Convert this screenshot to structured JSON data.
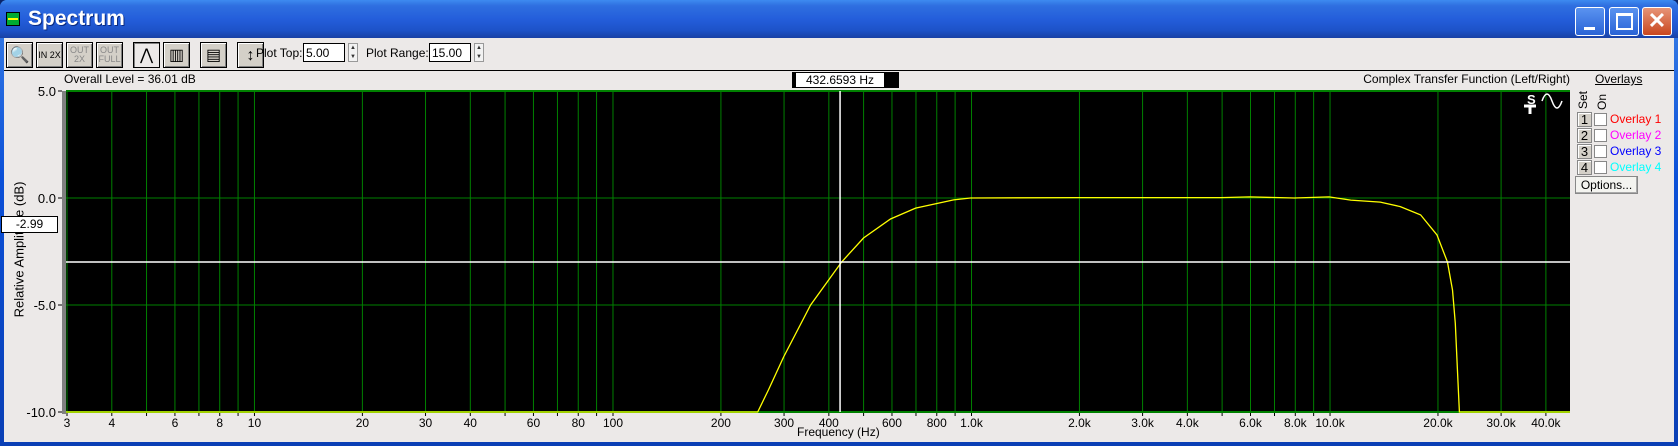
{
  "window": {
    "title": "Spectrum",
    "controls": [
      "minimize",
      "maximize",
      "close"
    ]
  },
  "toolbar": {
    "buttons": [
      {
        "name": "zoom-button",
        "icon": "magnifier-icon",
        "text": "",
        "enabled": true
      },
      {
        "name": "zoom-in-2x-button",
        "icon": "zoom-in-icon",
        "text": "IN 2X",
        "enabled": true
      },
      {
        "name": "zoom-out-2x-button",
        "icon": "zoom-out-icon",
        "text": "OUT 2X",
        "enabled": false
      },
      {
        "name": "zoom-out-full-button",
        "icon": "zoom-out-full-icon",
        "text": "OUT FULL",
        "enabled": false
      },
      {
        "name": "line-graph-button",
        "icon": "peak-line-icon",
        "text": "",
        "enabled": true,
        "pressed": true
      },
      {
        "name": "bar-graph-button",
        "icon": "bars-icon",
        "text": "",
        "enabled": true
      },
      {
        "name": "table-view-button",
        "icon": "table-icon",
        "text": "",
        "enabled": true
      },
      {
        "name": "autoscale-button",
        "icon": "vertical-range-icon",
        "text": "",
        "enabled": true
      }
    ],
    "plot_top_label": "Plot Top:",
    "plot_top_value": "5.00",
    "plot_range_label": "Plot Range:",
    "plot_range_value": "15.00"
  },
  "plot": {
    "overall_level": "Overall Level = 36.01 dB",
    "cursor_freq": "432.6593 Hz",
    "cursor_value": "-2.99",
    "mode_title": "Complex Transfer Function (Left/Right)"
  },
  "overlays": {
    "title": "Overlays",
    "set_label": "Set",
    "on_label": "On",
    "items": [
      {
        "num": "1",
        "label": "Overlay 1",
        "color": "#ff0000",
        "on": false
      },
      {
        "num": "2",
        "label": "Overlay 2",
        "color": "#ff00ff",
        "on": false
      },
      {
        "num": "3",
        "label": "Overlay 3",
        "color": "#0000ff",
        "on": false
      },
      {
        "num": "4",
        "label": "Overlay 4",
        "color": "#00ffff",
        "on": false
      }
    ],
    "options_label": "Options..."
  },
  "chart_data": {
    "type": "line",
    "xlabel": "Frequency (Hz)",
    "ylabel": "Relative Amplitude (dB)",
    "xscale": "log",
    "xlim": [
      3,
      47000
    ],
    "ylim": [
      -10,
      5
    ],
    "yticks": [
      5,
      0,
      -5,
      -10
    ],
    "ytick_labels": [
      "5.0",
      "0.0",
      "-5.0",
      "-10.0"
    ],
    "xticks": [
      3,
      4,
      6,
      8,
      10,
      20,
      30,
      40,
      60,
      80,
      100,
      200,
      300,
      400,
      600,
      800,
      1000,
      2000,
      3000,
      4000,
      6000,
      8000,
      10000,
      20000,
      30000,
      40000
    ],
    "xtick_labels": [
      "3",
      "4",
      "6",
      "8",
      "10",
      "20",
      "30",
      "40",
      "60",
      "80",
      "100",
      "200",
      "300",
      "400",
      "600",
      "800",
      "1.0k",
      "2.0k",
      "3.0k",
      "4.0k",
      "6.0k",
      "8.0k",
      "10.0k",
      "20.0k",
      "30.0k",
      "40.0k"
    ],
    "grid": true,
    "colors": {
      "background": "#000000",
      "grid": "#008000",
      "trace": "#ffff00",
      "cursor": "#ffffff"
    },
    "cursor": {
      "x": 432.6593,
      "y": -2.99
    },
    "series": [
      {
        "x": [
          3,
          255,
          273,
          301,
          358,
          437,
          503,
          598,
          703,
          897,
          1000,
          2000,
          5000,
          6000,
          8000,
          10000,
          11500,
          13900,
          15800,
          18000,
          20000,
          21400,
          22100,
          22500,
          22800,
          23100,
          47000
        ],
        "y": [
          -10,
          -10,
          -8.97,
          -7.43,
          -5.0,
          -2.99,
          -1.87,
          -0.98,
          -0.47,
          -0.09,
          0,
          0.02,
          0.02,
          0.05,
          0,
          0.05,
          -0.1,
          -0.19,
          -0.4,
          -0.79,
          -1.73,
          -3.0,
          -4.3,
          -5.85,
          -8.0,
          -10,
          -10
        ]
      }
    ]
  }
}
